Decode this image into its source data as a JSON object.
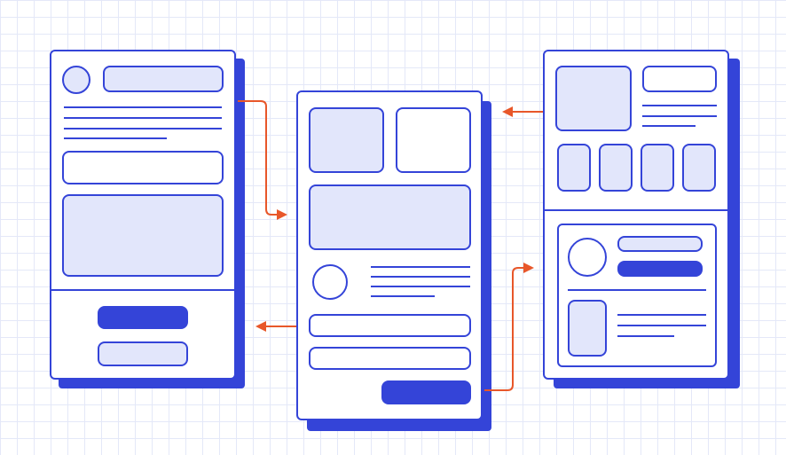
{
  "colors": {
    "primary": "#3444d8",
    "fill": "#e2e6fb",
    "background": "#ffffff",
    "grid": "#e4e8f8",
    "arrow": "#e8572a"
  },
  "screens": [
    {
      "name": "left-screen",
      "icon": "profile-form-wireframe"
    },
    {
      "name": "middle-screen",
      "icon": "gallery-detail-wireframe"
    },
    {
      "name": "right-screen",
      "icon": "dashboard-wireframe"
    }
  ],
  "connections": [
    {
      "from": "left-screen",
      "to": "middle-screen",
      "icon": "arrow-right-icon"
    },
    {
      "from": "middle-screen",
      "to": "left-screen",
      "icon": "arrow-left-icon"
    },
    {
      "from": "middle-screen",
      "to": "right-screen",
      "icon": "arrow-right-icon"
    },
    {
      "from": "right-screen",
      "to": "middle-screen",
      "icon": "arrow-left-icon"
    }
  ]
}
